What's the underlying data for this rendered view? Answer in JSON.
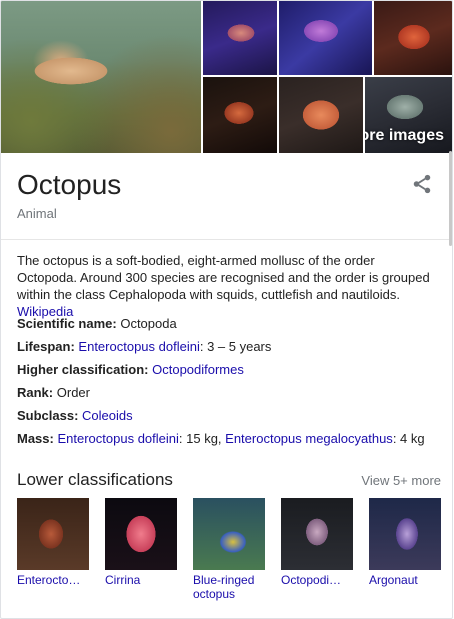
{
  "images": {
    "more_label": "More images"
  },
  "entity": {
    "title": "Octopus",
    "subtitle": "Animal"
  },
  "description": {
    "text": "The octopus is a soft-bodied, eight-armed mollusc of the order Octopoda. Around 300 species are recognised and the order is grouped within the class Cephalopoda with squids, cuttlefish and nautiloids.",
    "source": "Wikipedia"
  },
  "facts": {
    "scientific_name": {
      "label": "Scientific name:",
      "value": "Octopoda"
    },
    "lifespan": {
      "label": "Lifespan:",
      "link": "Enteroctopus dofleini",
      "value": ": 3 – 5 years"
    },
    "higher_classification": {
      "label": "Higher classification:",
      "link": "Octopodiformes"
    },
    "rank": {
      "label": "Rank:",
      "value": "Order"
    },
    "subclass": {
      "label": "Subclass:",
      "link": "Coleoids"
    },
    "mass": {
      "label": "Mass:",
      "link1": "Enteroctopus dofleini",
      "value1": ": 15 kg, ",
      "link2": "Enteroctopus megalocyathus",
      "value2": ": 4 kg"
    }
  },
  "lower_classifications": {
    "title": "Lower classifications",
    "view_more": "View 5+ more",
    "items": [
      {
        "label": "Enterocto…"
      },
      {
        "label": "Cirrina"
      },
      {
        "label": "Blue-ringed octopus"
      },
      {
        "label": "Octopodi…"
      },
      {
        "label": "Argonaut"
      }
    ]
  }
}
